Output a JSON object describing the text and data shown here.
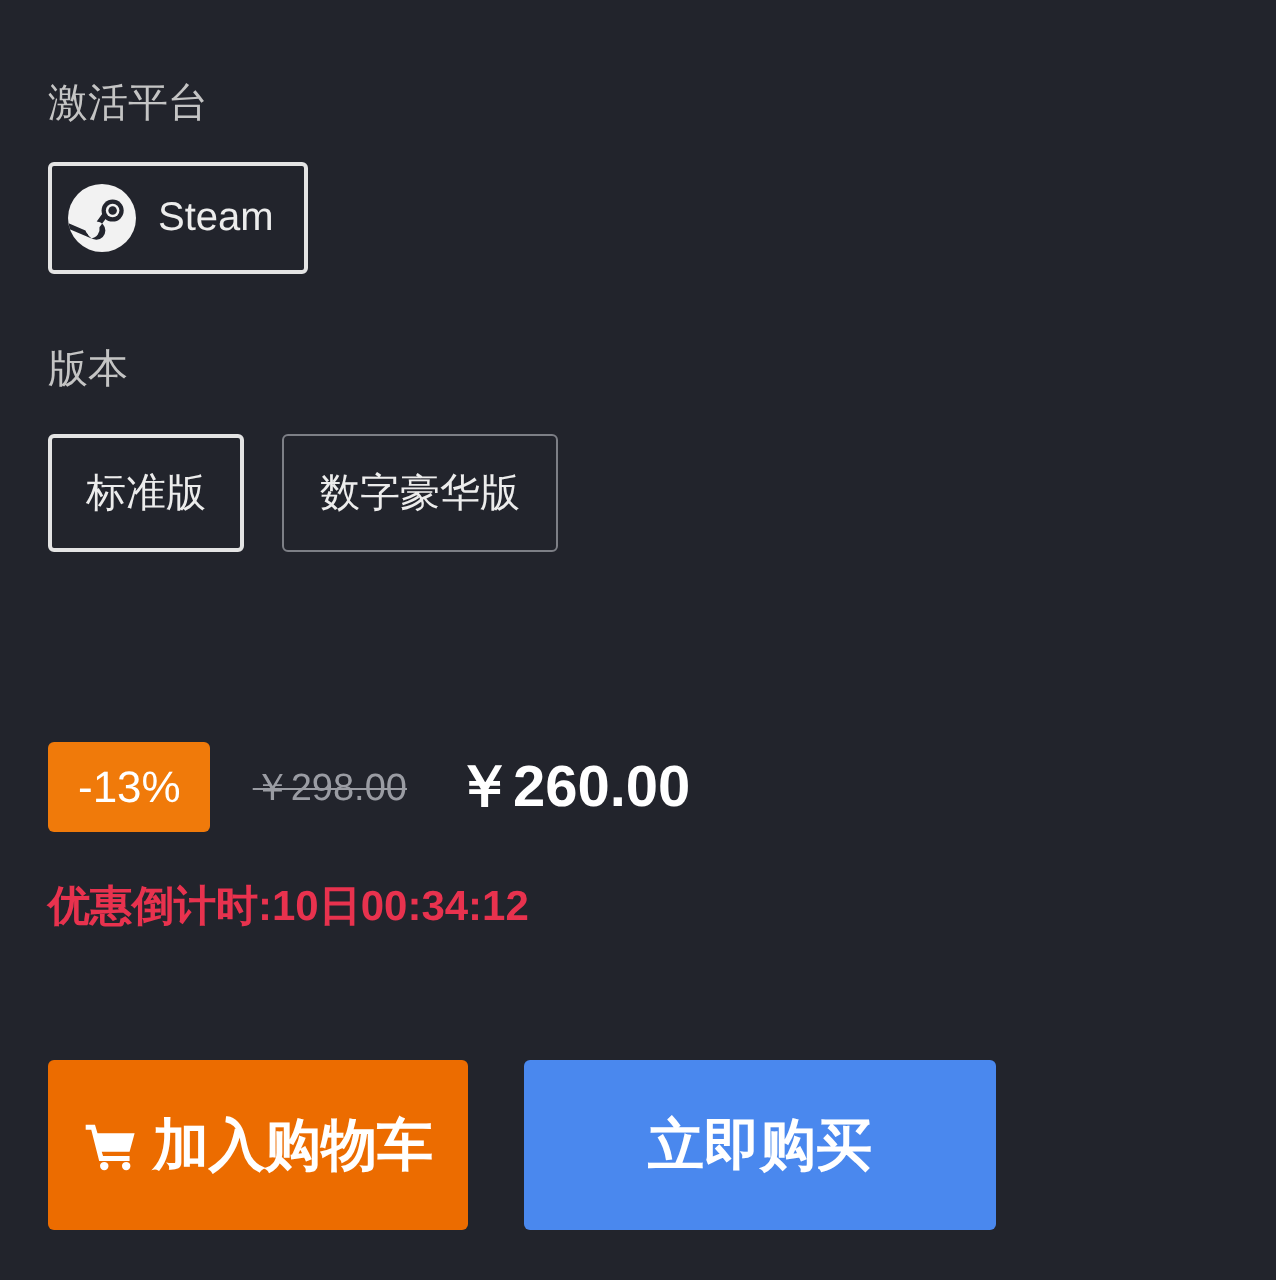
{
  "platform": {
    "label": "激活平台",
    "options": [
      {
        "label": "Steam",
        "selected": true
      }
    ]
  },
  "edition": {
    "label": "版本",
    "options": [
      {
        "label": "标准版",
        "selected": true
      },
      {
        "label": "数字豪华版",
        "selected": false
      }
    ]
  },
  "price": {
    "discount": "-13%",
    "original": "￥298.00",
    "current": "￥260.00",
    "countdown": "优惠倒计时:10日00:34:12"
  },
  "buttons": [
    {
      "kind": "cart",
      "label": "加入购物车"
    },
    {
      "kind": "buy",
      "label": "立即购买"
    }
  ]
}
